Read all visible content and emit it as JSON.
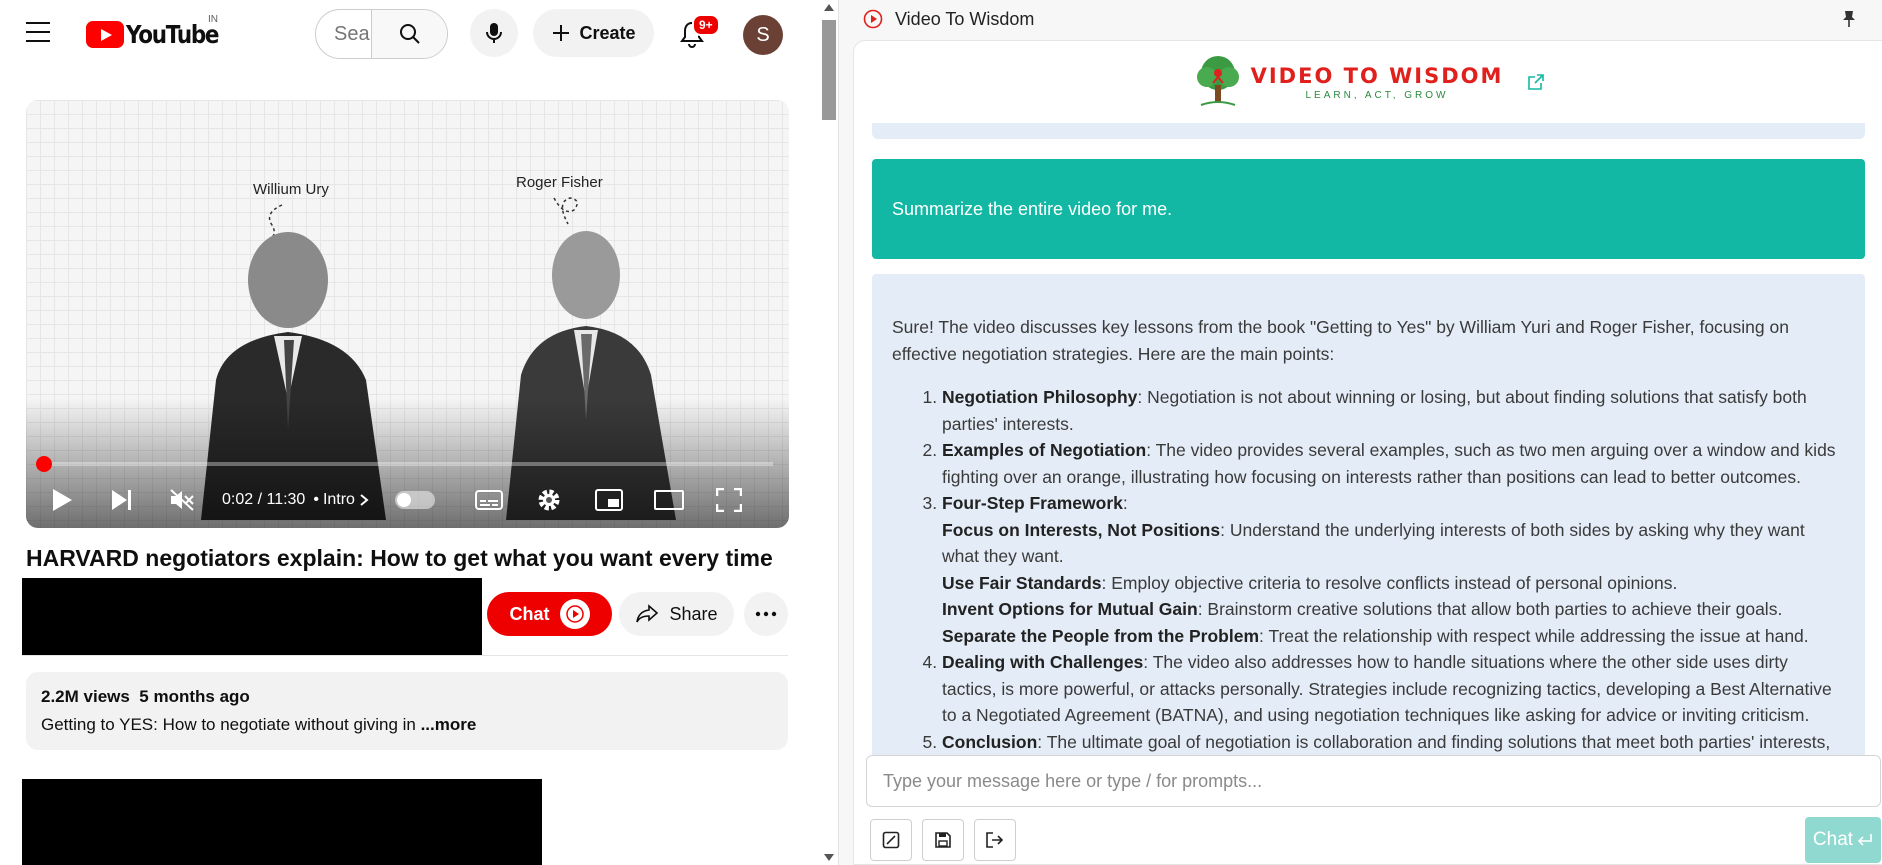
{
  "youtube": {
    "brand": "YouTube",
    "region": "IN",
    "search": {
      "placeholder": "Search"
    },
    "create_label": "Create",
    "notifications_badge": "9+",
    "avatar_initial": "S",
    "player": {
      "label_left": "Willium Ury",
      "label_right": "Roger Fisher",
      "time": "0:02 / 11:30",
      "chapter": "Intro",
      "progress_fraction": 0.003
    },
    "video_title": "HARVARD negotiators explain: How to get what you want every time",
    "chat_label": "Chat",
    "share_label": "Share",
    "description": {
      "views": "2.2M views",
      "age": "5 months ago",
      "snippet": "Getting to YES: How to negotiate without giving in ",
      "more": "...more"
    }
  },
  "sidebar": {
    "title": "Video To Wisdom",
    "brand_name": "VIDEO TO WISDOM",
    "brand_tagline": "LEARN, ACT, GROW",
    "user_message": "Summarize the entire video for me.",
    "bot_intro": "Sure! The video discusses key lessons from the book \"Getting to Yes\" by William Yuri and Roger Fisher, focusing on effective negotiation strategies. Here are the main points:",
    "points": [
      {
        "title": "Negotiation Philosophy",
        "text": ": Negotiation is not about winning or losing, but about finding solutions that satisfy both parties' interests."
      },
      {
        "title": "Examples of Negotiation",
        "text": ": The video provides several examples, such as two men arguing over a window and kids fighting over an orange, illustrating how focusing on interests rather than positions can lead to better outcomes."
      },
      {
        "title": "Four-Step Framework",
        "text": ":",
        "sub": [
          {
            "title": "Focus on Interests, Not Positions",
            "text": ": Understand the underlying interests of both sides by asking why they want what they want."
          },
          {
            "title": "Use Fair Standards",
            "text": ": Employ objective criteria to resolve conflicts instead of personal opinions."
          },
          {
            "title": "Invent Options for Mutual Gain",
            "text": ": Brainstorm creative solutions that allow both parties to achieve their goals."
          },
          {
            "title": "Separate the People from the Problem",
            "text": ": Treat the relationship with respect while addressing the issue at hand."
          }
        ]
      },
      {
        "title": "Dealing with Challenges",
        "text": ": The video also addresses how to handle situations where the other side uses dirty tactics, is more powerful, or attacks personally. Strategies include recognizing tactics, developing a Best Alternative to a Negotiated Agreement (BATNA), and using negotiation techniques like asking for advice or inviting criticism."
      },
      {
        "title": "Conclusion",
        "text": ": The ultimate goal of negotiation is collaboration and finding solutions that meet both parties' interests,"
      }
    ],
    "input_placeholder": "Type your message here or type / for prompts...",
    "send_label": "Chat",
    "colors": {
      "accent": "#13b8a4",
      "brand_red": "#e0201c",
      "bot_bubble": "#e4ecf7"
    }
  }
}
